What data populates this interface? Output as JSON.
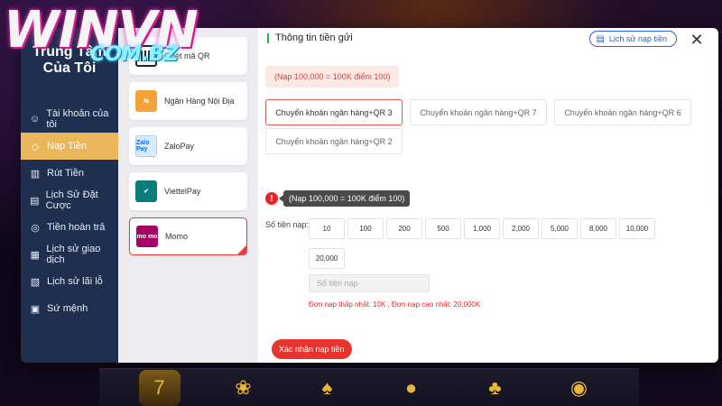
{
  "brand": {
    "logo_main": "WINVN",
    "logo_sub": "COM.BZ"
  },
  "nav": {
    "title": "Trung Tâm\nCủa Tôi",
    "items": [
      {
        "label": "Tài khoản của tôi",
        "icon": "user-icon"
      },
      {
        "label": "Nạp Tiền",
        "icon": "tag-icon",
        "active": true
      },
      {
        "label": "Rút Tiền",
        "icon": "withdraw-icon"
      },
      {
        "label": "Lịch Sử Đặt Cược",
        "icon": "bet-history-icon"
      },
      {
        "label": "Tiền hoàn trả",
        "icon": "refund-icon"
      },
      {
        "label": "Lịch sử giao dịch",
        "icon": "transaction-icon"
      },
      {
        "label": "Lịch sử lãi lỗ",
        "icon": "profit-loss-icon"
      },
      {
        "label": "Sứ mệnh",
        "icon": "gift-icon"
      }
    ]
  },
  "methods": [
    {
      "label": "Quét mã QR",
      "logo": "qr-icon",
      "logo_text": ""
    },
    {
      "label": "Ngân Hàng Nội Địa",
      "logo": "bank-icon",
      "logo_text": ""
    },
    {
      "label": "ZaloPay",
      "logo": "zalopay-logo",
      "logo_text": "Zalo Pay"
    },
    {
      "label": "ViettelPay",
      "logo": "viettelpay-logo",
      "logo_text": ""
    },
    {
      "label": "Momo",
      "logo": "momo-logo",
      "logo_text": "mo mo",
      "selected": true
    }
  ],
  "header": {
    "title": "Thông tin tiền gửi",
    "history_button": "Lịch sử nạp tiền",
    "close": "✕"
  },
  "rate_note": "(Nạp 100,000 = 100K điểm 100)",
  "bank_options": [
    {
      "label": "Chuyển khoản ngân hàng+QR 3",
      "selected": true
    },
    {
      "label": "Chuyển khoản ngân hàng+QR 7"
    },
    {
      "label": "Chuyển khoản ngân hàng+QR 6"
    },
    {
      "label": "Chuyển khoản ngân hàng+QR 2"
    }
  ],
  "warning": {
    "icon": "!",
    "tooltip": "(Nạp 100,000 = 100K điểm 100)"
  },
  "amount": {
    "label": "Số tiền nạp:",
    "options": [
      "10",
      "100",
      "200",
      "500",
      "1,000",
      "2,000",
      "5,000",
      "8,000",
      "10,000",
      "20,000"
    ],
    "placeholder": "Số tiền nạp",
    "limits": "Đơn nạp thấp nhất:  10K ,  Đơn nạp cao nhất:  20,000K"
  },
  "confirm_button": "Xác nhận nạp tiền",
  "background_games": [
    "slots-icon",
    "fishing-icon",
    "cards-icon",
    "soccer-icon",
    "club-icon",
    "gamepad-icon"
  ],
  "colors": {
    "nav_bg": "#1e2f4f",
    "nav_active": "#e9b659",
    "accent_red": "#e8342e",
    "header_green": "#21b94b",
    "history_blue": "#2a5fcf"
  }
}
